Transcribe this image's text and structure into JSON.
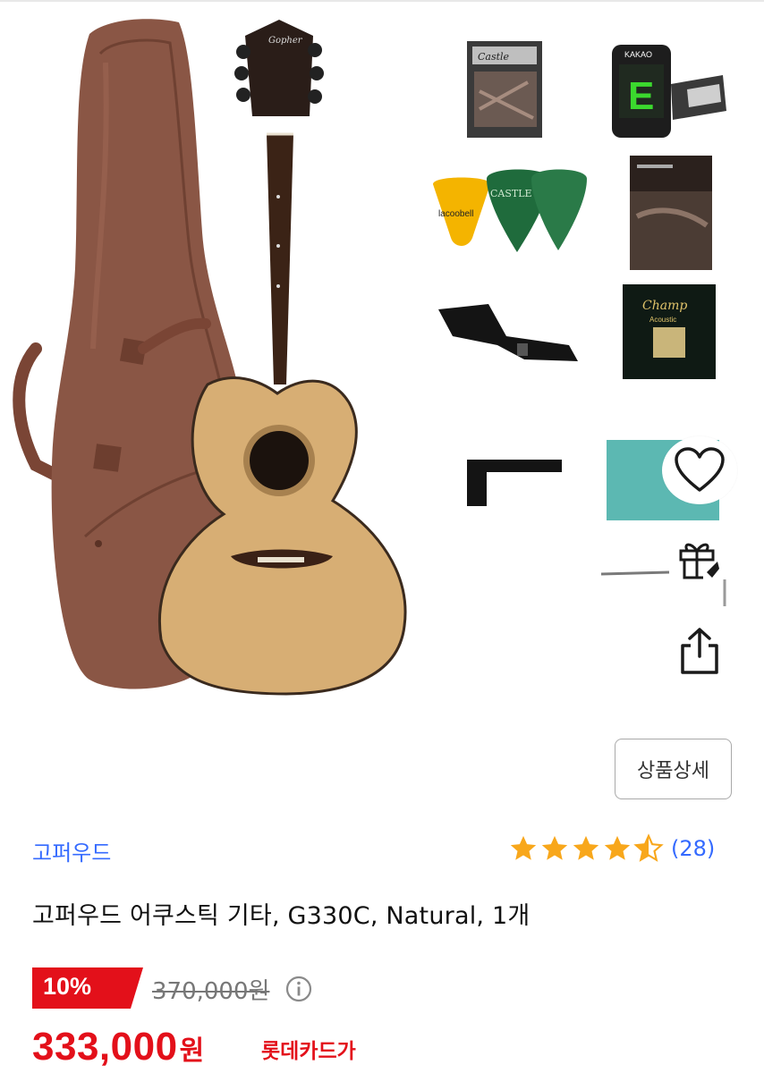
{
  "product": {
    "brand": "고퍼우드",
    "title": "고퍼우드 어쿠스틱 기타, G330C, Natural, 1개",
    "rating": 4.5,
    "review_count": "(28)",
    "detail_button": "상품상세"
  },
  "price": {
    "discount_badge": "10%",
    "original_price": "370,000원",
    "sale_price_number": "333,000",
    "sale_price_unit": "원",
    "card_label": "롯데카드가"
  },
  "image_labels": {
    "strings_pack": "Castle",
    "tuner": "KAKAO",
    "tuner_display": "E",
    "pick_holder": "lacoobell",
    "pick": "CASTLE",
    "strings_box": "Champ",
    "strings_box_sub": "Acoustic"
  },
  "icons": {
    "wishlist": "heart-icon",
    "gift": "gift-icon",
    "share": "share-icon",
    "info": "info-icon",
    "star": "star-icon"
  },
  "colors": {
    "accent_blue": "#346aff",
    "price_red": "#e3101a",
    "star_gold": "#f8a71b"
  }
}
